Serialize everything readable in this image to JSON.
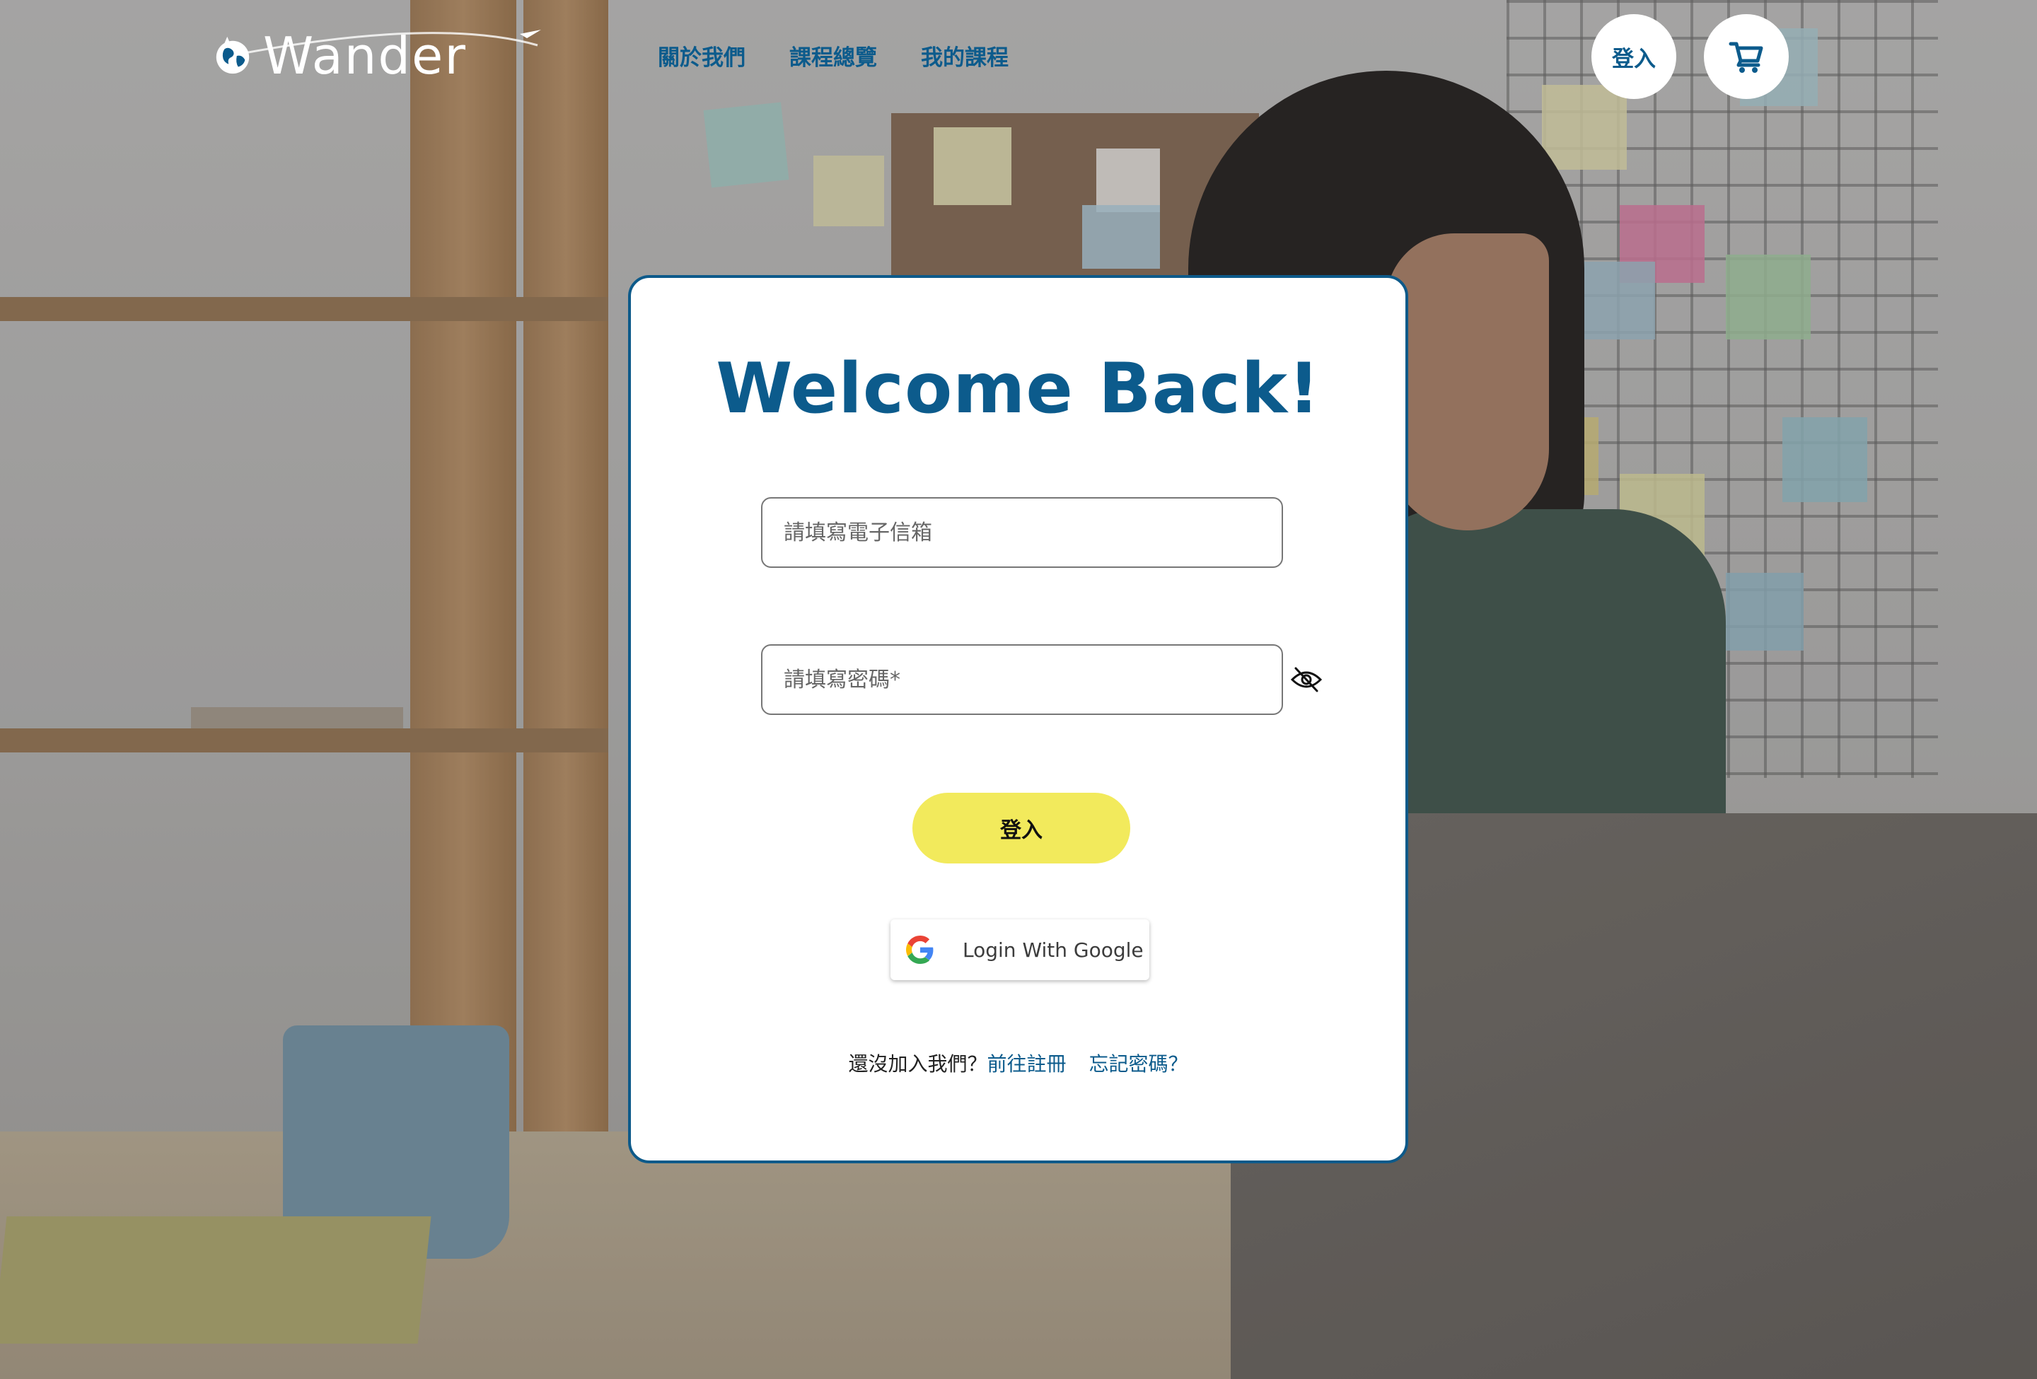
{
  "header": {
    "logo_text": "Wander",
    "nav": [
      {
        "label": "關於我們"
      },
      {
        "label": "課程總覽"
      },
      {
        "label": "我的課程"
      }
    ],
    "login_label": "登入",
    "cart_icon": "cart-icon"
  },
  "card": {
    "title": "Welcome Back!",
    "email_placeholder": "請填寫電子信箱",
    "password_placeholder": "請填寫密碼*",
    "eye_icon": "eye-off-icon",
    "submit_label": "登入",
    "google_label": "Login With Google",
    "footer": {
      "prompt": "還沒加入我們？",
      "register_link": "前往註冊",
      "forgot_link": "忘記密碼？"
    }
  },
  "colors": {
    "primary": "#0c5b8c",
    "accent_yellow": "#f2ea5c",
    "card_border": "#0d5a8a"
  }
}
